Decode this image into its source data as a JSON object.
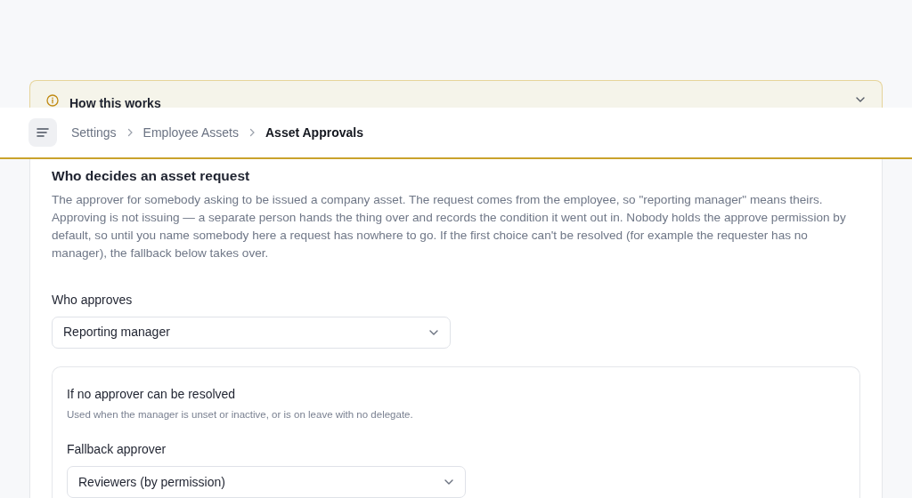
{
  "banner": {
    "title": "How this works",
    "expanded": false
  },
  "breadcrumb": [
    {
      "label": "Settings",
      "current": false
    },
    {
      "label": "Employee Assets",
      "current": false
    },
    {
      "label": "Asset Approvals",
      "current": true
    }
  ],
  "section": {
    "title": "Who decides an asset request",
    "description": "The approver for somebody asking to be issued a company asset. The request comes from the employee, so \"reporting manager\" means theirs. Approving is not issuing — a separate person hands the thing over and records the condition it went out in. Nobody holds the approve permission by default, so until you name somebody here a request has nowhere to go. If the first choice can't be resolved (for example the requester has no manager), the fallback below takes over."
  },
  "approver": {
    "label": "Who approves",
    "value": "Reporting manager"
  },
  "fallback": {
    "title": "If no approver can be resolved",
    "hint": "Used when the manager is unset or inactive, or is on leave with no delegate.",
    "label": "Fallback approver",
    "value": "Reviewers (by permission)"
  }
}
